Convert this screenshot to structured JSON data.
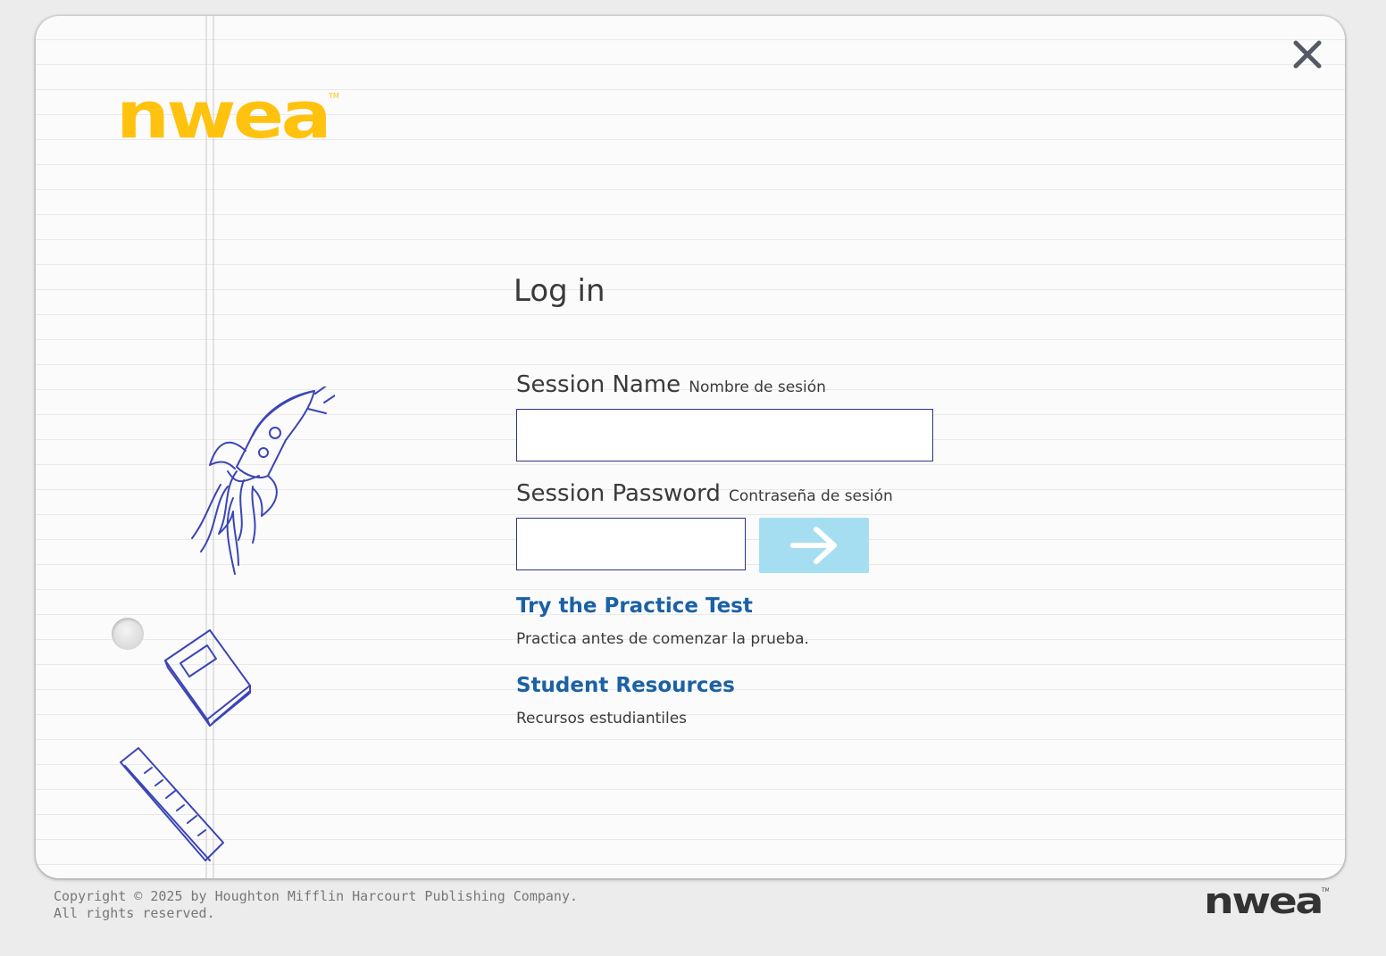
{
  "brand": {
    "name": "nwea",
    "trademark": "TM",
    "logo_color": "#FFC20E",
    "footer_logo_color": "#333333"
  },
  "dialog": {
    "close_icon": "close-icon"
  },
  "login": {
    "title": "Log in",
    "session_name": {
      "label": "Session Name",
      "label_es": "Nombre de sesión",
      "value": ""
    },
    "session_password": {
      "label": "Session Password",
      "label_es": "Contraseña de sesión",
      "value": ""
    },
    "submit_icon": "arrow-right-icon"
  },
  "links": {
    "practice_test": {
      "label": "Try the Practice Test",
      "subtitle": "Practica antes de comenzar la prueba."
    },
    "student_resources": {
      "label": "Student Resources",
      "subtitle": "Recursos estudiantiles"
    }
  },
  "footer": {
    "copyright": "Copyright © 2025 by Houghton Mifflin Harcourt Publishing Company. All rights reserved."
  },
  "colors": {
    "link": "#1B61A5",
    "input_border": "#2D3487",
    "submit_bg": "#A6DEF1",
    "doodle_ink": "#3B45B5"
  }
}
